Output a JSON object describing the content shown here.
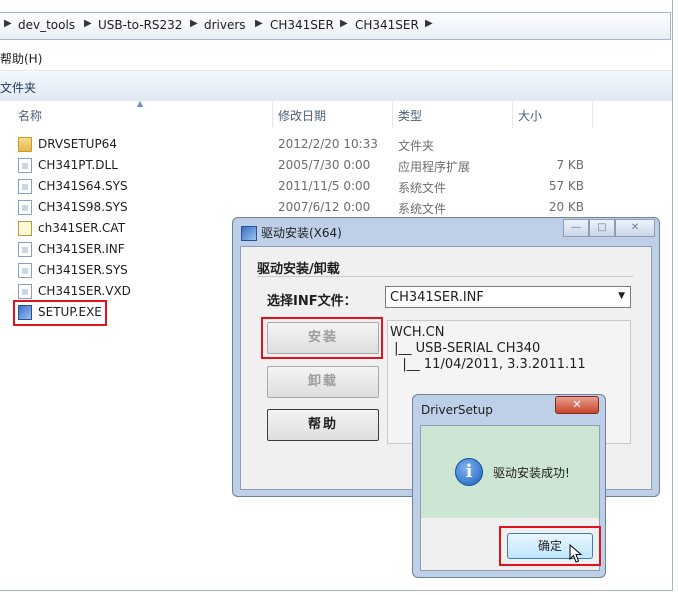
{
  "explorer": {
    "breadcrumbs": [
      "dev_tools",
      "USB-to-RS232",
      "drivers",
      "CH341SER",
      "CH341SER"
    ],
    "menu_help": "帮助(H)",
    "toolbar_new_folder": "文件夹",
    "columns": {
      "name": "名称",
      "modified": "修改日期",
      "type": "类型",
      "size": "大小"
    },
    "files": [
      {
        "name": "DRVSETUP64",
        "modified": "2012/2/20 10:33",
        "type": "文件夹",
        "size": "",
        "icon": "folder-icon"
      },
      {
        "name": "CH341PT.DLL",
        "modified": "2005/7/30 0:00",
        "type": "应用程序扩展",
        "size": "7 KB",
        "icon": "file-icon"
      },
      {
        "name": "CH341S64.SYS",
        "modified": "2011/11/5 0:00",
        "type": "系统文件",
        "size": "57 KB",
        "icon": "file-icon"
      },
      {
        "name": "CH341S98.SYS",
        "modified": "2007/6/12 0:00",
        "type": "系统文件",
        "size": "20 KB",
        "icon": "file-icon"
      },
      {
        "name": "ch341SER.CAT",
        "modified": "",
        "type": "",
        "size": "",
        "icon": "cat-icon"
      },
      {
        "name": "CH341SER.INF",
        "modified": "",
        "type": "",
        "size": "",
        "icon": "file-icon"
      },
      {
        "name": "CH341SER.SYS",
        "modified": "",
        "type": "",
        "size": "",
        "icon": "file-icon"
      },
      {
        "name": "CH341SER.VXD",
        "modified": "",
        "type": "",
        "size": "",
        "icon": "file-icon"
      },
      {
        "name": "SETUP.EXE",
        "modified": "",
        "type": "",
        "size": "",
        "icon": "setup-icon"
      }
    ]
  },
  "installer": {
    "title": "驱动安装(X64)",
    "group_title": "驱动安装/卸载",
    "inf_label": "选择INF文件：",
    "inf_value": "CH341SER.INF",
    "install_label": "安装",
    "uninstall_label": "卸载",
    "help_label": "帮助",
    "info_lines": [
      "WCH.CN",
      " |__ USB-SERIAL CH340",
      "   |__ 11/04/2011, 3.3.2011.11"
    ]
  },
  "msgbox": {
    "title": "DriverSetup",
    "message": "驱动安装成功!",
    "ok_label": "确定"
  },
  "colors": {
    "highlight_red": "#e0141e",
    "dialog_frame": "#bdd0e7",
    "msg_area": "#cde5d3"
  }
}
